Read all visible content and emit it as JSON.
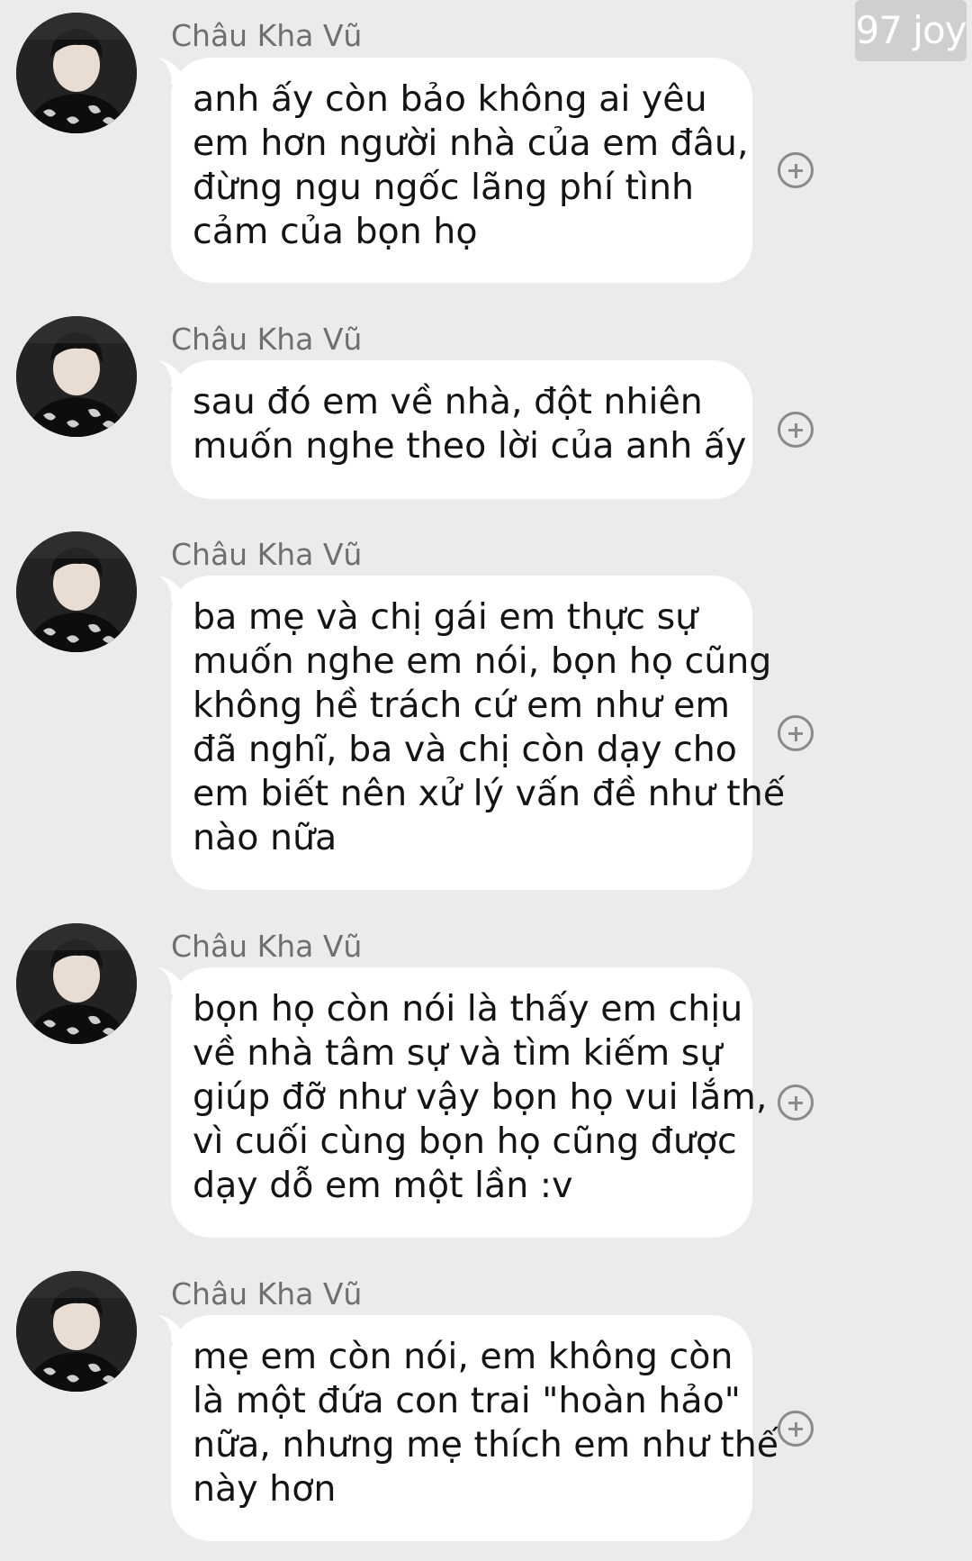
{
  "watermark": "97 joy",
  "messages": [
    {
      "sender": "Châu Kha Vũ",
      "lines": [
        "anh ấy còn bảo không ai yêu",
        "em hơn người nhà của em đâu,",
        "đừng ngu ngốc lãng phí tình",
        "cảm của bọn họ"
      ]
    },
    {
      "sender": "Châu Kha Vũ",
      "lines": [
        "sau đó em về nhà, đột nhiên",
        "muốn nghe theo lời của anh ấy"
      ]
    },
    {
      "sender": "Châu Kha Vũ",
      "lines": [
        "ba mẹ và chị gái em thực sự",
        "muốn nghe em nói, bọn họ cũng",
        "không hề trách cứ em như em",
        "đã nghĩ, ba và chị còn dạy cho",
        "em biết nên xử lý vấn đề như thế",
        "nào nữa"
      ]
    },
    {
      "sender": "Châu Kha Vũ",
      "lines": [
        "bọn họ còn nói là thấy em chịu",
        "về nhà tâm sự và tìm kiếm sự",
        "giúp đỡ như vậy bọn họ vui lắm,",
        "vì cuối cùng bọn họ cũng được",
        "dạy dỗ em một lần :v"
      ]
    },
    {
      "sender": "Châu Kha Vũ",
      "lines": [
        "mẹ em còn nói, em không còn",
        "là một đứa con trai \"hoàn hảo\"",
        "nữa, nhưng mẹ thích em như thế",
        "này hơn"
      ]
    }
  ]
}
